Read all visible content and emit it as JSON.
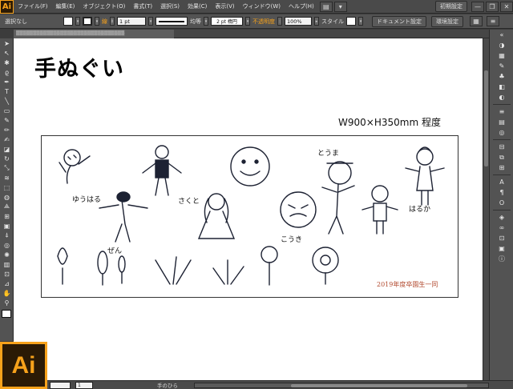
{
  "app": {
    "logo_small": "Ai",
    "logo_big": "Ai",
    "menu": [
      "ファイル(F)",
      "編集(E)",
      "オブジェクト(O)",
      "書式(T)",
      "選択(S)",
      "効果(C)",
      "表示(V)",
      "ウィンドウ(W)",
      "ヘルプ(H)"
    ],
    "workspace": "初期設定",
    "window_buttons": [
      "—",
      "❐",
      "✕"
    ]
  },
  "control_bar": {
    "selection": "選択なし",
    "stroke_label": "線",
    "stroke_width": "1 pt",
    "stroke_profile": "均等",
    "brush": "2 pt 楕円",
    "opacity_label": "不透明度",
    "opacity_value": "100%",
    "style_label": "スタイル",
    "doc_settings": "ドキュメント設定",
    "prefs": "環境設定"
  },
  "document": {
    "title": "手ぬぐい",
    "size": "W900×H350mm 程度",
    "grad_text": "2019年度卒園生一同",
    "kid_names": [
      "ゆうはる",
      "さくと",
      "こうき",
      "とうま",
      "はるか",
      "ぜん"
    ]
  },
  "status": {
    "zoom": "",
    "page": "1",
    "tool_name": "手のひら"
  },
  "colors": {
    "accent": "#f7a21b",
    "ui_dark": "#535353",
    "canvas": "#ffffff"
  },
  "icons": {
    "left_tools": [
      "selection-icon",
      "direct-selection-icon",
      "magic-wand-icon",
      "lasso-icon",
      "pen-icon",
      "type-icon",
      "line-icon",
      "rectangle-icon",
      "paintbrush-icon",
      "pencil-icon",
      "blob-brush-icon",
      "eraser-icon",
      "rotate-icon",
      "scale-icon",
      "warp-icon",
      "free-transform-icon",
      "shape-builder-icon",
      "perspective-icon",
      "mesh-icon",
      "gradient-icon",
      "eyedropper-icon",
      "blend-icon",
      "symbol-sprayer-icon",
      "graph-icon",
      "artboard-icon",
      "slice-icon",
      "hand-icon",
      "zoom-icon"
    ],
    "right_panels": [
      "color-icon",
      "swatches-icon",
      "brushes-icon",
      "symbols-icon",
      "graphic-styles-icon",
      "appearance-icon",
      "layers-icon",
      "stroke-icon",
      "gradient-panel-icon",
      "transparency-icon",
      "align-icon",
      "pathfinder-icon",
      "transform-icon",
      "character-icon",
      "paragraph-icon",
      "opentype-icon",
      "links-icon",
      "artboards-panel-icon"
    ]
  }
}
